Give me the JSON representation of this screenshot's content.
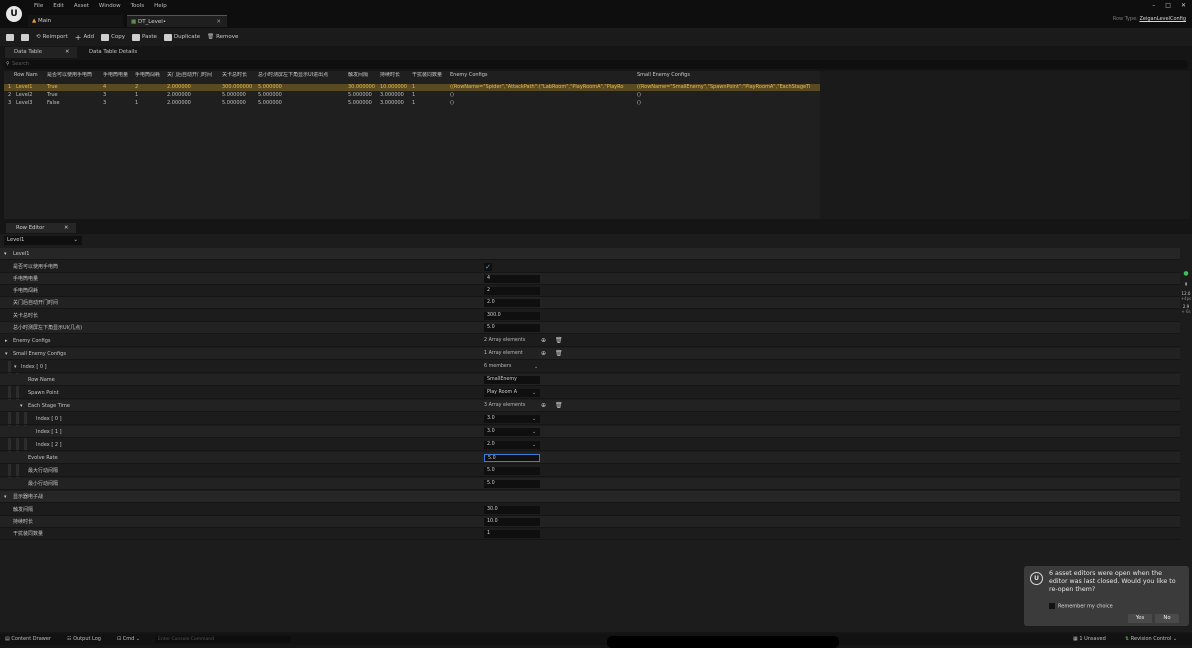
{
  "menus": [
    "File",
    "Edit",
    "Asset",
    "Window",
    "Tools",
    "Help"
  ],
  "tabs": [
    {
      "label": "Main"
    },
    {
      "label": "DT_Level•"
    }
  ],
  "window_controls": [
    "–",
    "□",
    "✕"
  ],
  "parent_type": {
    "label": "Row Type:",
    "value": "ZeiganLevelConfig"
  },
  "toolbar": {
    "reimport": "Reimport",
    "add": "Add",
    "copy": "Copy",
    "paste": "Paste",
    "duplicate": "Duplicate",
    "remove": "Remove"
  },
  "dt_tabs": [
    "Data Table",
    "Data Table Details"
  ],
  "search": {
    "placeholder": "Search"
  },
  "table": {
    "headers": [
      "Row Nam",
      "是否可以使用手电筒",
      "手电筒电量",
      "手电筒闯耗",
      "关门后自动开门时间",
      "关卡总时长",
      "总小时测屏左下角显示UI进出点",
      "触发间隔",
      "持续时长",
      "干扰装同数量",
      "Enemy Configs",
      "Small Enemy Configs"
    ],
    "rows": [
      {
        "idx": "1",
        "name": "Level1",
        "flash": "True",
        "power": "4",
        "cost": "2",
        "door": "2.000000",
        "total": "300.000000",
        "ui": "5.000000",
        "interval": "30.000000",
        "duration": "10.000000",
        "count": "1",
        "enemy": "((RowName=\"Spider\",\"AttackPath\":(\"LabRoom\",\"PlayRoomA\",\"PlayRo",
        "small": "((RowName=\"SmallEnemy\",\"SpawnPoint\":\"PlayRoomA\",\"EachStageTi"
      },
      {
        "idx": "2",
        "name": "Level2",
        "flash": "True",
        "power": "3",
        "cost": "1",
        "door": "2.000000",
        "total": "5.000000",
        "ui": "5.000000",
        "interval": "5.000000",
        "duration": "3.000000",
        "count": "1",
        "enemy": "()",
        "small": "()"
      },
      {
        "idx": "3",
        "name": "Level3",
        "flash": "False",
        "power": "3",
        "cost": "1",
        "door": "2.000000",
        "total": "5.000000",
        "ui": "5.000000",
        "interval": "5.000000",
        "duration": "3.000000",
        "count": "1",
        "enemy": "()",
        "small": "()"
      }
    ]
  },
  "row_editor": {
    "tab": "Row Editor",
    "selected_row": "Level1",
    "category": "Level1",
    "props": [
      {
        "label": "是否可以使用手电筒",
        "value": "✓"
      },
      {
        "label": "手电筒电量",
        "value": "4"
      },
      {
        "label": "手电筒闯耗",
        "value": "2"
      },
      {
        "label": "关门后自动开门时间",
        "value": "2.0"
      },
      {
        "label": "关卡总时长",
        "value": "300.0"
      },
      {
        "label": "总小时测屏左下角显示UI(几点)",
        "value": "5.0"
      }
    ],
    "enemy_configs": {
      "label": "Enemy Configs",
      "value": "2 Array elements"
    },
    "small_enemy_configs": {
      "label": "Small Enemy Configs",
      "value": "1 Array element"
    },
    "index0": {
      "label": "Index [ 0 ]",
      "value": "6 members"
    },
    "row_name": {
      "label": "Row Name",
      "value": "SmallEnemy"
    },
    "spawn_point": {
      "label": "Spawn Point",
      "value": "Play Room A"
    },
    "each_stage": {
      "label": "Each Stage Time",
      "value": "3 Array elements"
    },
    "stage_items": [
      {
        "label": "Index [ 0 ]",
        "value": "3.0"
      },
      {
        "label": "Index [ 1 ]",
        "value": "3.0"
      },
      {
        "label": "Index [ 2 ]",
        "value": "2.0"
      }
    ],
    "evolve_rate": {
      "label": "Evolve Rate",
      "value": "5.0"
    },
    "max_attack": {
      "label": "最大行动间隔",
      "value": "5.0"
    },
    "min_attack": {
      "label": "最小行动间隔",
      "value": "5.0"
    },
    "category2": "显示器电子战",
    "tail_props": [
      {
        "label": "触发间隔",
        "value": "30.0"
      },
      {
        "label": "持续时长",
        "value": "10.0"
      },
      {
        "label": "干扰装同数量",
        "value": "1"
      }
    ]
  },
  "right_tools": [
    "12.0",
    "+4ps",
    "2.9",
    "+ 6s"
  ],
  "toast": {
    "message": "6 asset editors were open when the editor was last closed. Would you like to re-open them?",
    "remember": "Remember my choice",
    "yes": "Yes",
    "no": "No"
  },
  "statusbar": {
    "content_drawer": "Content Drawer",
    "output_log": "Output Log",
    "cmd": "Cmd",
    "cmd_placeholder": "Enter Console Command",
    "unsaved": "1 Unsaved",
    "revision": "Revision Control"
  }
}
